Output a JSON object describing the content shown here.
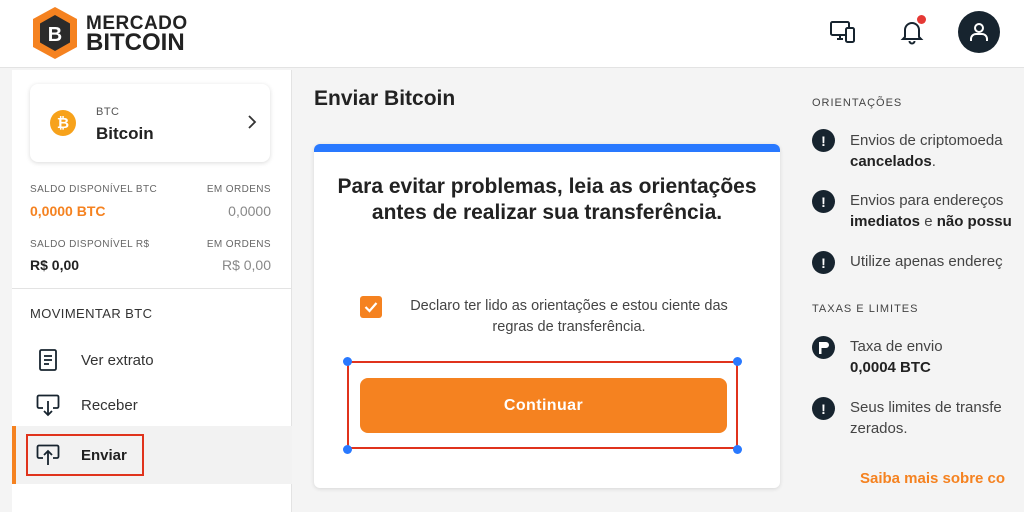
{
  "header": {
    "logo_line1": "MERCADO",
    "logo_line2": "BITCOIN",
    "logo_mark": "B",
    "icons": [
      "devices-icon",
      "bell-icon",
      "user-icon"
    ]
  },
  "sidebar": {
    "coin": {
      "symbol": "₿",
      "code": "BTC",
      "name": "Bitcoin"
    },
    "balances": [
      {
        "label": "SALDO DISPONÍVEL BTC",
        "value": "0,0000 BTC",
        "orders_label": "EM ORDENS",
        "orders_value": "0,0000"
      },
      {
        "label": "SALDO DISPONÍVEL R$",
        "value": "R$ 0,00",
        "orders_label": "EM ORDENS",
        "orders_value": "R$ 0,00"
      }
    ],
    "section_title": "MOVIMENTAR BTC",
    "items": [
      {
        "label": "Ver extrato",
        "icon": "statement-icon"
      },
      {
        "label": "Receber",
        "icon": "receive-icon"
      },
      {
        "label": "Enviar",
        "icon": "send-icon",
        "active": true
      }
    ]
  },
  "main": {
    "title": "Enviar Bitcoin",
    "card": {
      "heading": "Para evitar problemas, leia as orientações antes de realizar sua transferência.",
      "checkbox_label": "Declaro ter lido as orientações e estou ciente das regras de transferência.",
      "checkbox_checked": true,
      "continue_label": "Continuar"
    }
  },
  "right": {
    "guidelines_title": "ORIENTAÇÕES",
    "g1_text": "Envios de criptomoeda",
    "g1_bold": "cancelados",
    "g2_text": "Envios para endereços",
    "g2_bold1": "imediatos",
    "g2_mid": " e ",
    "g2_bold2": "não possu",
    "g3_text": "Utilize apenas endereç",
    "fees_title": "TAXAS E LIMITES",
    "fee_label": "Taxa de envio",
    "fee_value": "0,0004 BTC",
    "limits_line1": "Seus limites de transfe",
    "limits_line2": "zerados.",
    "saiba_mais": "Saiba mais sobre co"
  },
  "colors": {
    "accent": "#f58220",
    "dark": "#17242f",
    "highlight": "#e0331c",
    "blue": "#2979ff"
  }
}
